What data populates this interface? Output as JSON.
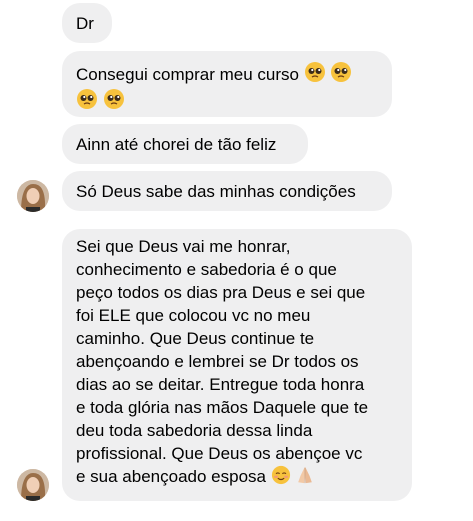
{
  "messages": [
    {
      "id": "msg1",
      "text": "Dr"
    },
    {
      "id": "msg2",
      "lines": [
        "Consegui comprar meu curso"
      ],
      "emojis": [
        "pleading-face",
        "pleading-face",
        "pleading-face",
        "pleading-face"
      ]
    },
    {
      "id": "msg3",
      "text": "Ainn até chorei de tão feliz"
    },
    {
      "id": "msg4",
      "text": "Só Deus sabe das minhas condições"
    },
    {
      "id": "msg5",
      "lines": [
        "Sei que Deus vai me honrar,",
        "conhecimento e sabedoria é o que",
        "peço todos os dias pra Deus e sei que",
        "foi ELE que colocou vc no meu",
        "caminho. Que Deus continue te",
        "abençoando e lembrei se Dr todos os",
        "dias ao se deitar. Entregue toda honra",
        "e toda glória nas mãos Daquele que te",
        "deu toda sabedoria dessa linda",
        "profissional. Que Deus os abençoe vc",
        "e sua abençoado esposa"
      ],
      "emojis": [
        "smiling-face",
        "folded-hands"
      ]
    }
  ],
  "avatars": [
    "sender-avatar",
    "sender-avatar"
  ],
  "colors": {
    "bubble": "#efeff0",
    "text": "#000000",
    "background": "#ffffff",
    "emoji_face": "#f7c23d"
  }
}
